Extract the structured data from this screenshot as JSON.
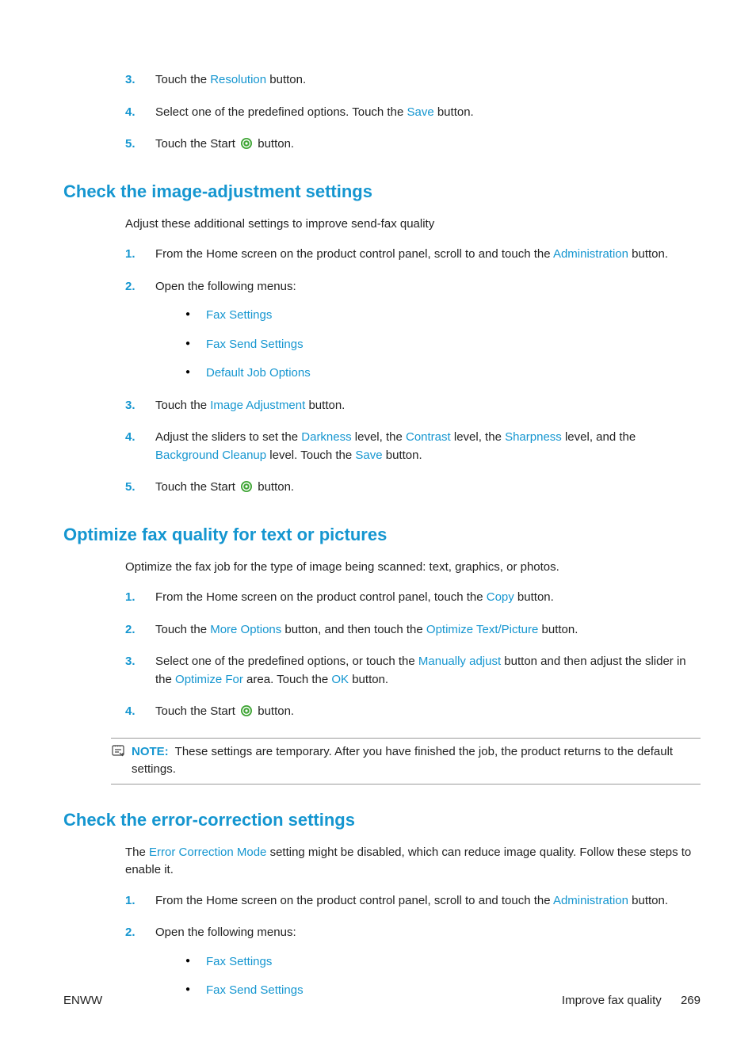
{
  "sec_top": {
    "step3": {
      "t1": "Touch the ",
      "r": "Resolution",
      "t2": " button."
    },
    "step4": {
      "t1": "Select one of the predefined options. Touch the ",
      "s": "Save",
      "t2": " button."
    },
    "step5": {
      "t1": "Touch the Start ",
      "t2": " button."
    }
  },
  "sec_image": {
    "h": "Check the image-adjustment settings",
    "intro": "Adjust these additional settings to improve send-fax quality",
    "step1": {
      "t1": "From the Home screen on the product control panel, scroll to and touch the ",
      "a": "Administration",
      "t2": " button."
    },
    "step2": {
      "t1": "Open the following menus:",
      "b1": "Fax Settings",
      "b2": "Fax Send Settings",
      "b3": "Default Job Options"
    },
    "step3": {
      "t1": "Touch the ",
      "ia": "Image Adjustment",
      "t2": " button."
    },
    "step4": {
      "t1": "Adjust the sliders to set the ",
      "d": "Darkness",
      "t2": " level, the ",
      "c": "Contrast",
      "t3": " level, the ",
      "sh": "Sharpness",
      "t4": " level, and the ",
      "bc": "Background Cleanup",
      "t5": " level. Touch the ",
      "s": "Save",
      "t6": " button."
    },
    "step5": {
      "t1": "Touch the Start ",
      "t2": " button."
    }
  },
  "sec_opt": {
    "h": "Optimize fax quality for text or pictures",
    "intro": "Optimize the fax job for the type of image being scanned: text, graphics, or photos.",
    "step1": {
      "t1": "From the Home screen on the product control panel, touch the ",
      "c": "Copy",
      "t2": " button."
    },
    "step2": {
      "t1": "Touch the ",
      "mo": "More Options",
      "t2": " button, and then touch the ",
      "otp": "Optimize Text/Picture",
      "t3": " button."
    },
    "step3": {
      "t1": "Select one of the predefined options, or touch the ",
      "ma": "Manually adjust",
      "t2": " button and then adjust the slider in the ",
      "of": "Optimize For",
      "t3": " area. Touch the ",
      "ok": "OK",
      "t4": " button."
    },
    "step4": {
      "t1": "Touch the Start ",
      "t2": " button."
    },
    "note": {
      "label": "NOTE:",
      "text": "These settings are temporary. After you have finished the job, the product returns to the default settings."
    }
  },
  "sec_err": {
    "h": "Check the error-correction settings",
    "intro": {
      "t1": "The ",
      "ecm": "Error Correction Mode",
      "t2": " setting might be disabled, which can reduce image quality. Follow these steps to enable it."
    },
    "step1": {
      "t1": "From the Home screen on the product control panel, scroll to and touch the ",
      "a": "Administration",
      "t2": " button."
    },
    "step2": {
      "t1": "Open the following menus:",
      "b1": "Fax Settings",
      "b2": "Fax Send Settings"
    }
  },
  "footer": {
    "left": "ENWW",
    "right": "Improve fax quality",
    "page": "269"
  }
}
